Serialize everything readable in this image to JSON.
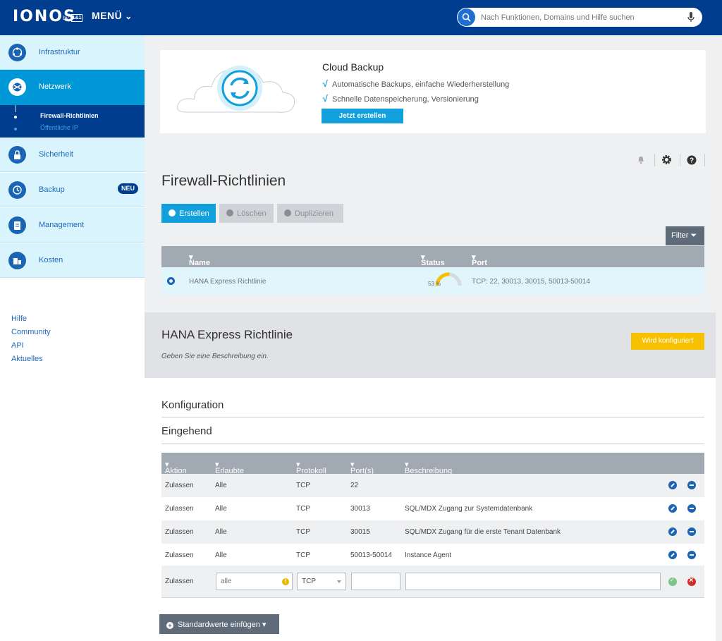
{
  "header": {
    "logo": "IONOS",
    "logo_by": "by",
    "logo_mark": "1&1",
    "menu_label": "MENÜ",
    "search_placeholder": "Nach Funktionen, Domains und Hilfe suchen"
  },
  "sidebar": {
    "items": [
      {
        "label": "Infrastruktur",
        "icon": "globe-icon"
      },
      {
        "label": "Netzwerk",
        "icon": "network-icon",
        "active": true
      },
      {
        "label": "Sicherheit",
        "icon": "lock-icon"
      },
      {
        "label": "Backup",
        "icon": "clock-icon",
        "badge": "NEU"
      },
      {
        "label": "Management",
        "icon": "clipboard-icon"
      },
      {
        "label": "Kosten",
        "icon": "coins-icon"
      }
    ],
    "sub_items": [
      "Firewall-Richtlinien",
      "Öffentliche IP"
    ],
    "links": [
      "Hilfe",
      "Community",
      "API",
      "Aktuelles"
    ]
  },
  "banner": {
    "title": "Cloud Backup",
    "features": [
      "Automatische Backups, einfache Wiederherstellung",
      "Schnelle Datenspeicherung, Versionierung"
    ],
    "button": "Jetzt erstellen"
  },
  "page": {
    "title": "Firewall-Richtlinien",
    "actions": {
      "create": "Erstellen",
      "delete": "Löschen",
      "duplicate": "Duplizieren"
    },
    "filter": "Filter"
  },
  "policy_list": {
    "columns": {
      "name": "Name",
      "status": "Status",
      "port": "Port"
    },
    "rows": [
      {
        "name": "HANA Express Richtlinie",
        "status": "53 %",
        "progress": 0.53,
        "port": "TCP: 22, 30013, 30015, 50013-50014"
      }
    ]
  },
  "detail": {
    "title": "HANA Express Richtlinie",
    "description": "Geben Sie eine Beschreibung ein.",
    "status": "Wird konfiguriert"
  },
  "config": {
    "title": "Konfiguration",
    "subtitle": "Eingehend",
    "columns": {
      "action": "Aktion",
      "allowed_ip": "Erlaubte IP",
      "protocol": "Protokoll",
      "ports": "Port(s)",
      "description": "Beschreibung"
    },
    "rules": [
      {
        "action": "Zulassen",
        "ip": "Alle",
        "protocol": "TCP",
        "ports": "22",
        "description": ""
      },
      {
        "action": "Zulassen",
        "ip": "Alle",
        "protocol": "TCP",
        "ports": "30013",
        "description": "SQL/MDX Zugang zur Systemdatenbank"
      },
      {
        "action": "Zulassen",
        "ip": "Alle",
        "protocol": "TCP",
        "ports": "30015",
        "description": "SQL/MDX Zugang für die erste Tenant Datenbank"
      },
      {
        "action": "Zulassen",
        "ip": "Alle",
        "protocol": "TCP",
        "ports": "50013-50014",
        "description": "Instance Agent"
      }
    ],
    "new_rule": {
      "action": "Zulassen",
      "ip_placeholder": "alle",
      "protocol": "TCP",
      "ports": "",
      "description": ""
    },
    "defaults_button": "Standardwerte einfügen"
  }
}
